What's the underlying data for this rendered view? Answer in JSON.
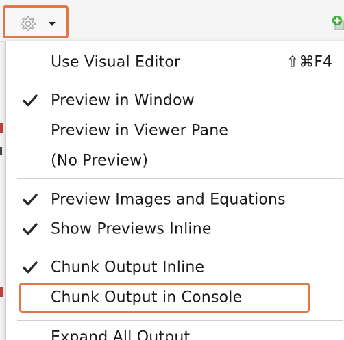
{
  "toolbar": {
    "gear_icon": "gear-icon",
    "dropdown_icon": "chevron-down-icon",
    "add_icon": "add-plus-icon"
  },
  "menu": {
    "items": [
      {
        "label": "Use Visual Editor",
        "shortcut": "⇧⌘F4",
        "checked": false
      },
      {
        "label": "Preview in Window",
        "checked": true
      },
      {
        "label": "Preview in Viewer Pane",
        "checked": false
      },
      {
        "label": "(No Preview)",
        "checked": false
      },
      {
        "label": "Preview Images and Equations",
        "checked": true
      },
      {
        "label": "Show Previews Inline",
        "checked": true
      },
      {
        "label": "Chunk Output Inline",
        "checked": true
      },
      {
        "label": "Chunk Output in Console",
        "checked": false,
        "highlighted": true
      },
      {
        "label": "Expand All Output",
        "checked": false
      }
    ]
  },
  "colors": {
    "highlight_border": "#e07848",
    "check": "#2a2a2a",
    "add_green": "#3fae3a"
  }
}
